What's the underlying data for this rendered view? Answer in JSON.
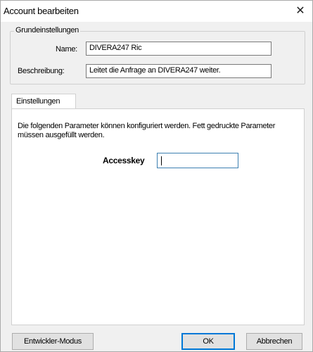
{
  "window": {
    "title": "Account bearbeiten",
    "close_glyph": "✕"
  },
  "general": {
    "legend": "Grundeinstellungen",
    "name_label": "Name:",
    "name_value": "DIVERA247 Ric",
    "description_label": "Beschreibung:",
    "description_value": "Leitet die Anfrage an DIVERA247 weiter."
  },
  "settings": {
    "tab_label": "Einstellungen",
    "description": "Die folgenden Parameter können konfiguriert werden. Fett gedruckte Parameter müssen ausgefüllt werden.",
    "accesskey_label": "Accesskey",
    "accesskey_value": ""
  },
  "footer": {
    "dev_mode_label": "Entwickler-Modus",
    "ok_label": "OK",
    "cancel_label": "Abbrechen"
  }
}
